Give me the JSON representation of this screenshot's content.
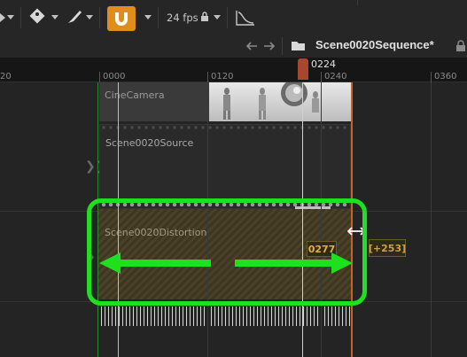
{
  "toolbar": {
    "fps_label": "24 fps",
    "icons": [
      "play-icon",
      "snap-tag-icon",
      "brush-icon",
      "magnet-icon",
      "lock-icon",
      "curve-editor-icon"
    ],
    "accent_color": "#e08d1c"
  },
  "navbar": {
    "sequence_title": "Scene0020Sequence*",
    "icons": [
      "back-arrow-icon",
      "forward-arrow-icon",
      "folder-icon",
      "lock-icon"
    ]
  },
  "ruler": {
    "ticks": [
      "20",
      "0000",
      "0120",
      "0240",
      "0360"
    ],
    "playhead": "0224"
  },
  "tracks": {
    "camera": {
      "label": "CineCamera"
    },
    "source": {
      "label": "Scene0020Source"
    },
    "distortion": {
      "label": "Scene0020Distortion",
      "frame": "0277",
      "delta": "[+253]"
    }
  },
  "colors": {
    "highlight": "#1fe01f",
    "playhead": "#a8472f",
    "end_marker": "#c8612a",
    "start_marker": "#2e8a2e"
  }
}
